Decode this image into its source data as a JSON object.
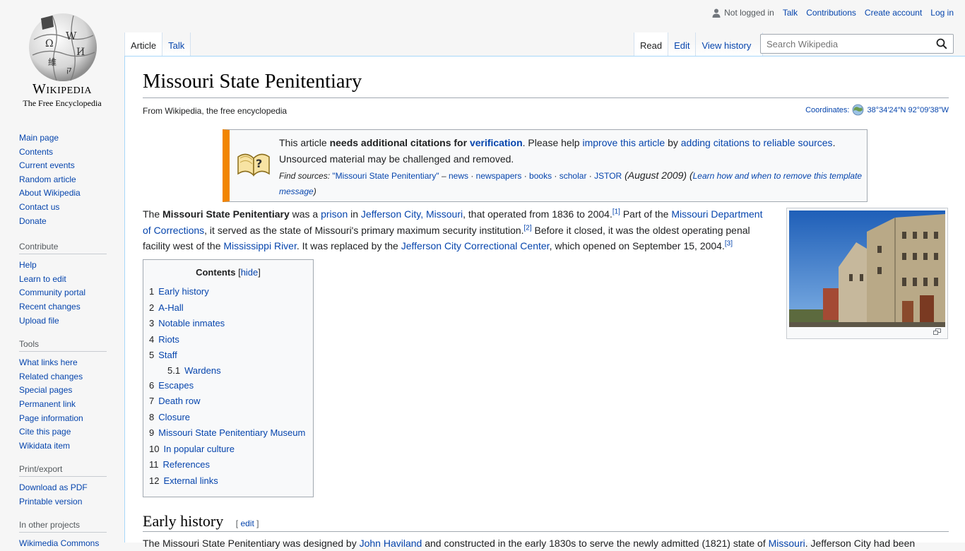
{
  "logo": {
    "wordmark": "Wikipedia",
    "tagline": "The Free Encyclopedia"
  },
  "personal": {
    "not_logged_in": "Not logged in",
    "links": [
      "Talk",
      "Contributions",
      "Create account",
      "Log in"
    ]
  },
  "tabs": {
    "left": [
      {
        "label": "Article",
        "selected": true
      },
      {
        "label": "Talk",
        "selected": false
      }
    ],
    "right": [
      {
        "label": "Read",
        "selected": true
      },
      {
        "label": "Edit",
        "selected": false
      },
      {
        "label": "View history",
        "selected": false
      }
    ]
  },
  "search": {
    "placeholder": "Search Wikipedia"
  },
  "sidebar": {
    "navigation": [
      "Main page",
      "Contents",
      "Current events",
      "Random article",
      "About Wikipedia",
      "Contact us",
      "Donate"
    ],
    "contribute": {
      "title": "Contribute",
      "items": [
        "Help",
        "Learn to edit",
        "Community portal",
        "Recent changes",
        "Upload file"
      ]
    },
    "tools": {
      "title": "Tools",
      "items": [
        "What links here",
        "Related changes",
        "Special pages",
        "Permanent link",
        "Page information",
        "Cite this page",
        "Wikidata item"
      ]
    },
    "print": {
      "title": "Print/export",
      "items": [
        "Download as PDF",
        "Printable version"
      ]
    },
    "projects": {
      "title": "In other projects",
      "items": [
        "Wikimedia Commons"
      ]
    }
  },
  "article": {
    "title": "Missouri State Penitentiary",
    "site_sub": "From Wikipedia, the free encyclopedia",
    "coordinates_label": "Coordinates:",
    "coordinates_value": "38°34′24″N 92°09′38″W"
  },
  "ambox": {
    "t1": "This article ",
    "t2": "needs additional citations for ",
    "t3": "verification",
    "t4": ". Please help ",
    "t5": "improve this article",
    "t6": " by ",
    "t7": "adding citations to reliable sources",
    "t8": ". Unsourced material may be challenged and removed.",
    "s1": "Find sources: ",
    "s2": "\"Missouri State Penitentiary\"",
    "s3": " – ",
    "s4": "news",
    "s5": "newspapers",
    "s6": "books",
    "s7": "scholar",
    "s8": "JSTOR",
    "s9": " (August 2009) (",
    "s10": "Learn how and when to remove this template message",
    "s11": ")"
  },
  "intro": {
    "p1": "The ",
    "p2": "Missouri State Penitentiary",
    "p3": " was a ",
    "p4": "prison",
    "p5": " in ",
    "p6": "Jefferson City, Missouri",
    "p7": ", that operated from 1836 to 2004.",
    "r1": "[1]",
    "p8": " Part of the ",
    "p9": "Missouri Department of Corrections",
    "p10": ", it served as the state of Missouri's primary maximum security institution.",
    "r2": "[2]",
    "p11": " Before it closed, it was the oldest operating penal facility west of the ",
    "p12": "Mississippi River",
    "p13": ". It was replaced by the ",
    "p14": "Jefferson City Correctional Center",
    "p15": ", which opened on September 15, 2004.",
    "r3": "[3]"
  },
  "toc": {
    "title": "Contents",
    "hide": "hide",
    "items": [
      {
        "num": "1",
        "label": "Early history"
      },
      {
        "num": "2",
        "label": "A-Hall"
      },
      {
        "num": "3",
        "label": "Notable inmates"
      },
      {
        "num": "4",
        "label": "Riots"
      },
      {
        "num": "5",
        "label": "Staff"
      },
      {
        "num": "5.1",
        "label": "Wardens"
      },
      {
        "num": "6",
        "label": "Escapes"
      },
      {
        "num": "7",
        "label": "Death row"
      },
      {
        "num": "8",
        "label": "Closure"
      },
      {
        "num": "9",
        "label": "Missouri State Penitentiary Museum"
      },
      {
        "num": "10",
        "label": "In popular culture"
      },
      {
        "num": "11",
        "label": "References"
      },
      {
        "num": "12",
        "label": "External links"
      }
    ]
  },
  "section": {
    "title": "Early history",
    "edit": "edit",
    "e1": "The Missouri State Penitentiary was designed by ",
    "e2": "John Haviland",
    "e3": " and constructed in the early 1830s to serve the newly admitted (1821) state of ",
    "e4": "Missouri",
    "e5": ". Jefferson City had been"
  },
  "colors": {
    "link": "#0645ad",
    "ambox_accent": "#f28500",
    "border": "#a2a9b1"
  }
}
